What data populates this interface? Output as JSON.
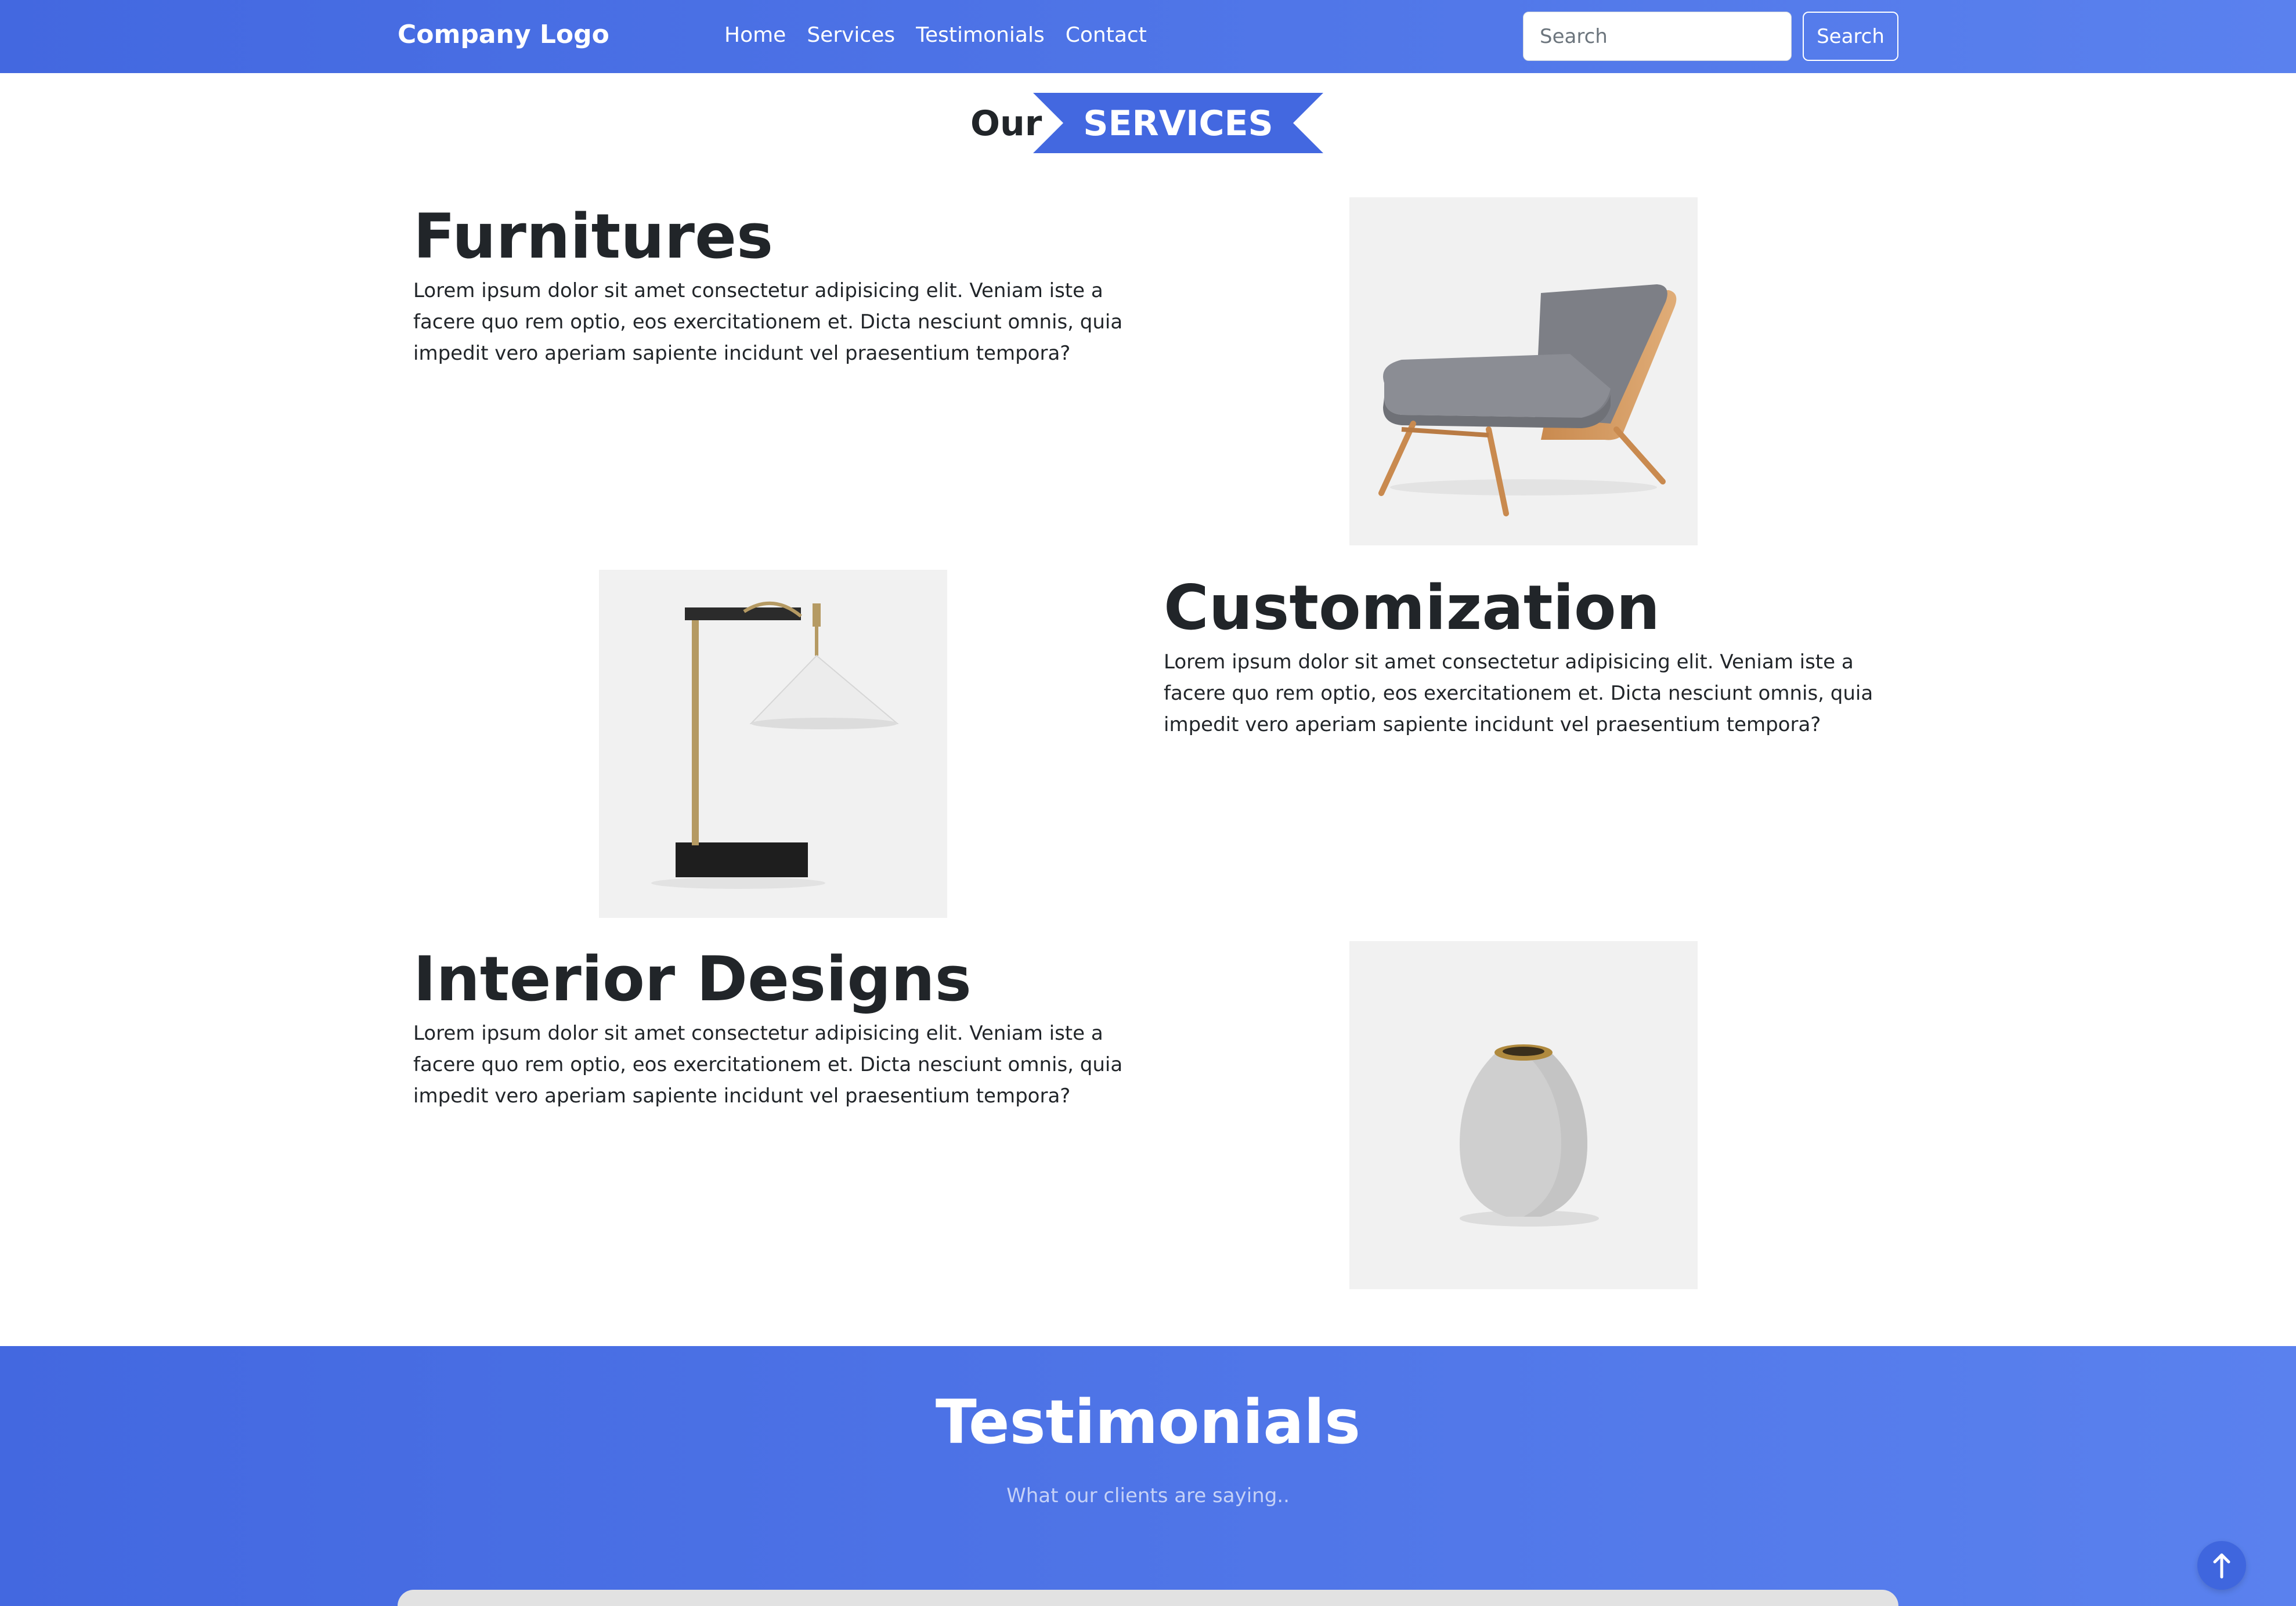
{
  "navbar": {
    "brand": "Company Logo",
    "links": [
      "Home",
      "Services",
      "Testimonials",
      "Contact"
    ],
    "search_placeholder": "Search",
    "search_button": "Search"
  },
  "services_title": {
    "prefix": "Our",
    "highlight": "SERVICES"
  },
  "services": [
    {
      "title": "Furnitures",
      "text": "Lorem ipsum dolor sit amet consectetur adipisicing elit. Veniam iste a facere quo rem optio, eos exercitationem et. Dicta nesciunt omnis, quia impedit vero aperiam sapiente incidunt vel praesentium tempora?",
      "image": "armchair-image"
    },
    {
      "title": "Customization",
      "text": "Lorem ipsum dolor sit amet consectetur adipisicing elit. Veniam iste a facere quo rem optio, eos exercitationem et. Dicta nesciunt omnis, quia impedit vero aperiam sapiente incidunt vel praesentium tempora?",
      "image": "desk-lamp-image"
    },
    {
      "title": "Interior Designs",
      "text": "Lorem ipsum dolor sit amet consectetur adipisicing elit. Veniam iste a facere quo rem optio, eos exercitationem et. Dicta nesciunt omnis, quia impedit vero aperiam sapiente incidunt vel praesentium tempora?",
      "image": "vase-image"
    }
  ],
  "testimonials": {
    "title": "Testimonials",
    "subtitle": "What our clients are saying.."
  },
  "colors": {
    "primary": "#4368e0",
    "primary_light": "#5a81ee",
    "text": "#212529"
  },
  "icons": {
    "back_to_top": "arrow-up-icon"
  }
}
